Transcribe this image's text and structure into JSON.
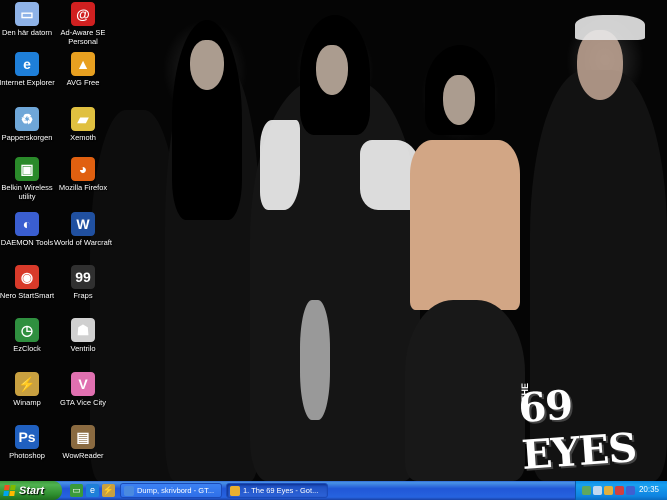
{
  "wallpaper": {
    "band_name": "69 EYES",
    "band_prefix": "THE"
  },
  "icons_left": [
    {
      "name": "den-har-datorn-icon",
      "label": "Den här datorn",
      "color": "#8fb3e8",
      "glyph": "▭"
    },
    {
      "name": "internet-explorer-icon",
      "label": "Internet Explorer",
      "color": "#1e7fd9",
      "glyph": "e"
    },
    {
      "name": "papperskorgen-icon",
      "label": "Papperskorgen",
      "color": "#6fa7d8",
      "glyph": "♻"
    },
    {
      "name": "belkin-icon",
      "label": "Belkin Wireless utility",
      "color": "#2a8a2a",
      "glyph": "▣"
    },
    {
      "name": "daemon-tools-icon",
      "label": "DAEMON Tools",
      "color": "#3a5ed0",
      "glyph": "◐"
    },
    {
      "name": "nero-icon",
      "label": "Nero StartSmart",
      "color": "#d83a2a",
      "glyph": "◉"
    },
    {
      "name": "ezclock-icon",
      "label": "EzClock",
      "color": "#2f8f3f",
      "glyph": "◷"
    },
    {
      "name": "winamp-icon",
      "label": "Winamp",
      "color": "#c8a040",
      "glyph": "⚡"
    },
    {
      "name": "photoshop-icon",
      "label": "Photoshop",
      "color": "#2060c0",
      "glyph": "Ps"
    }
  ],
  "icons_right": [
    {
      "name": "ad-aware-icon",
      "label": "Ad-Aware SE Personal",
      "color": "#d02020",
      "glyph": "@"
    },
    {
      "name": "avg-free-icon",
      "label": "AVG Free",
      "color": "#e8a020",
      "glyph": "▲"
    },
    {
      "name": "xemoth-icon",
      "label": "Xemoth",
      "color": "#e0c040",
      "glyph": "▰"
    },
    {
      "name": "mozilla-firefox-icon",
      "label": "Mozilla Firefox",
      "color": "#e06010",
      "glyph": "◕"
    },
    {
      "name": "world-of-warcraft-icon",
      "label": "World of Warcraft",
      "color": "#2050a0",
      "glyph": "W"
    },
    {
      "name": "fraps-icon",
      "label": "Fraps",
      "color": "#303030",
      "glyph": "99"
    },
    {
      "name": "ventrilo-icon",
      "label": "Ventrilo",
      "color": "#d0d0d0",
      "glyph": "☗"
    },
    {
      "name": "gta-vice-city-icon",
      "label": "GTA Vice City",
      "color": "#e070b0",
      "glyph": "V"
    },
    {
      "name": "wowreader-icon",
      "label": "WowReader",
      "color": "#8a6a40",
      "glyph": "▤"
    }
  ],
  "taskbar": {
    "start_label": "Start",
    "quick_launch": [
      {
        "name": "show-desktop-icon",
        "color": "#3a9a3a",
        "glyph": "▭"
      },
      {
        "name": "ie-quicklaunch-icon",
        "color": "#1e7fd9",
        "glyph": "e"
      },
      {
        "name": "winamp-quicklaunch-icon",
        "color": "#c8a040",
        "glyph": "⚡"
      }
    ],
    "tasks": [
      {
        "label": "Dump, skrivbord - GT...",
        "color": "#4a8ae0",
        "active": false
      },
      {
        "label": "1. The 69 Eyes - Got...",
        "color": "#e8b030",
        "active": true
      }
    ],
    "clock": "20:35"
  }
}
